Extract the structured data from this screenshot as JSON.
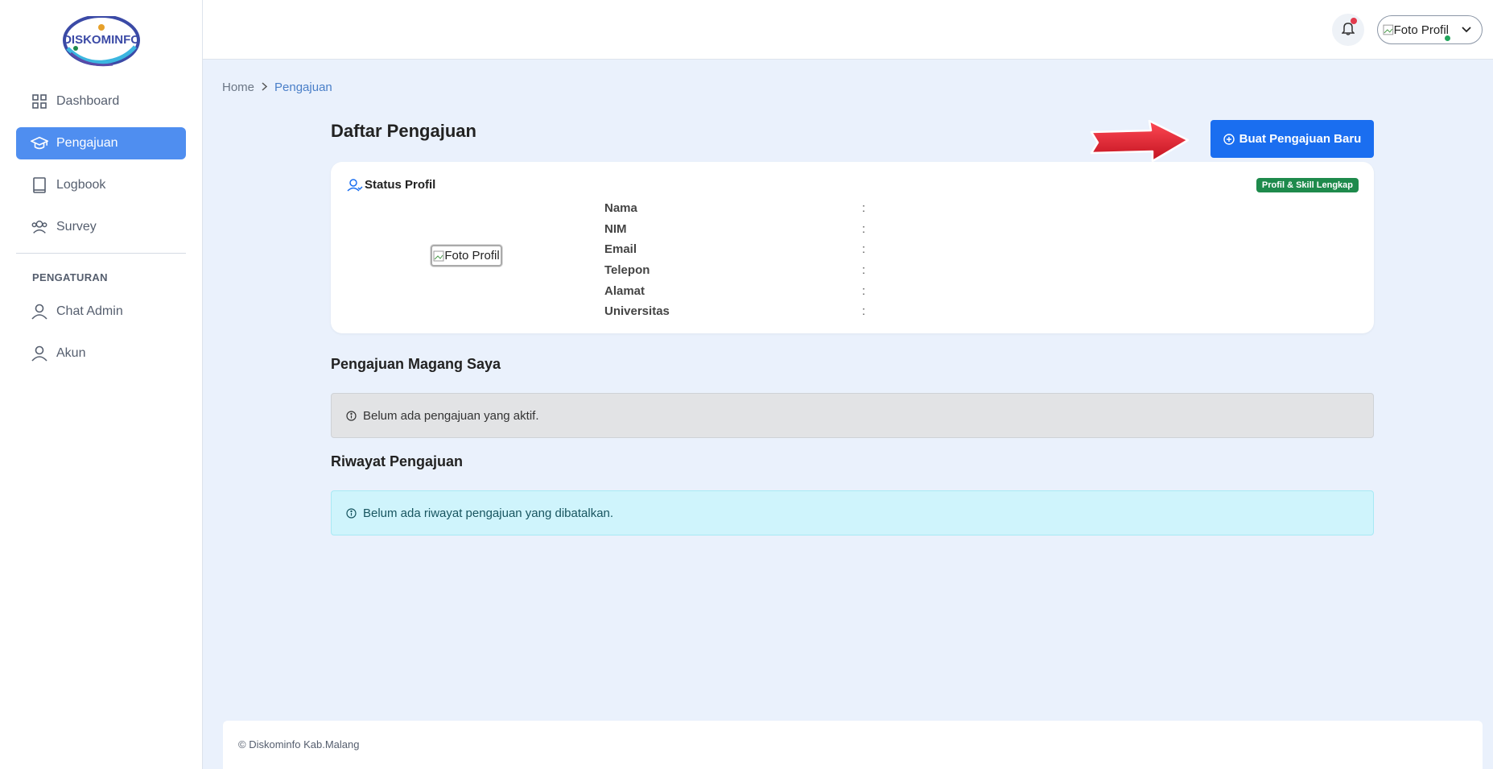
{
  "logo": {
    "text": "DISKOMINFO"
  },
  "sidebar": {
    "items": [
      {
        "label": "Dashboard",
        "icon": "grid-icon"
      },
      {
        "label": "Pengajuan",
        "icon": "graduation-cap-icon",
        "active": true
      },
      {
        "label": "Logbook",
        "icon": "book-icon"
      },
      {
        "label": "Survey",
        "icon": "users-icon"
      }
    ],
    "section_label": "PENGATURAN",
    "settings_items": [
      {
        "label": "Chat Admin",
        "icon": "user-icon"
      },
      {
        "label": "Akun",
        "icon": "user-icon"
      }
    ]
  },
  "header": {
    "profile_alt": "Foto Profil"
  },
  "breadcrumb": {
    "home": "Home",
    "current": "Pengajuan"
  },
  "page": {
    "title": "Daftar Pengajuan",
    "new_button": "Buat Pengajuan Baru"
  },
  "profile_card": {
    "title": "Status Profil",
    "badge": "Profil & Skill Lengkap",
    "photo_alt": "Foto Profil",
    "fields": [
      {
        "label": "Nama",
        "value": ""
      },
      {
        "label": "NIM",
        "value": ""
      },
      {
        "label": "Email",
        "value": ""
      },
      {
        "label": "Telepon",
        "value": ""
      },
      {
        "label": "Alamat",
        "value": ""
      },
      {
        "label": "Universitas",
        "value": ""
      }
    ]
  },
  "active_section": {
    "title": "Pengajuan Magang Saya",
    "empty_message": "Belum ada pengajuan yang aktif."
  },
  "history_section": {
    "title": "Riwayat Pengajuan",
    "empty_message": "Belum ada riwayat pengajuan yang dibatalkan."
  },
  "footer": {
    "text": "© Diskominfo Kab.Malang"
  },
  "colors": {
    "accent": "#1a6ef0",
    "active_nav": "#4f8ef0",
    "badge": "#1e8a4c",
    "arrow": "#e0202f"
  }
}
